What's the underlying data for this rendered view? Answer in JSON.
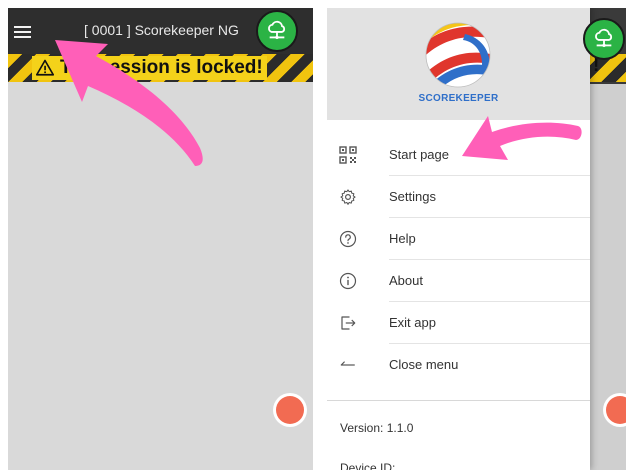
{
  "left_screen": {
    "app_title": "[ 0001 ] Scorekeeper NG",
    "locked_banner": "The session is locked!"
  },
  "drawer": {
    "logo_text": "SCOREKEEPER",
    "menu": [
      {
        "label": "Start page",
        "icon": "qr-code-icon"
      },
      {
        "label": "Settings",
        "icon": "gear-icon"
      },
      {
        "label": "Help",
        "icon": "help-circle-icon"
      },
      {
        "label": "About",
        "icon": "info-circle-icon"
      },
      {
        "label": "Exit app",
        "icon": "exit-icon"
      },
      {
        "label": "Close menu",
        "icon": "back-arrow-icon"
      }
    ],
    "version": "Version: 1.1.0",
    "device_id": "Device ID:"
  },
  "colors": {
    "topbar": "#2e2e2e",
    "cloud_button": "#2bb345",
    "fab": "#f26b52",
    "banner_yellow": "#f1c40f",
    "annotation_pink": "#ff5fb8",
    "logo_blue": "#2f6fc9"
  }
}
